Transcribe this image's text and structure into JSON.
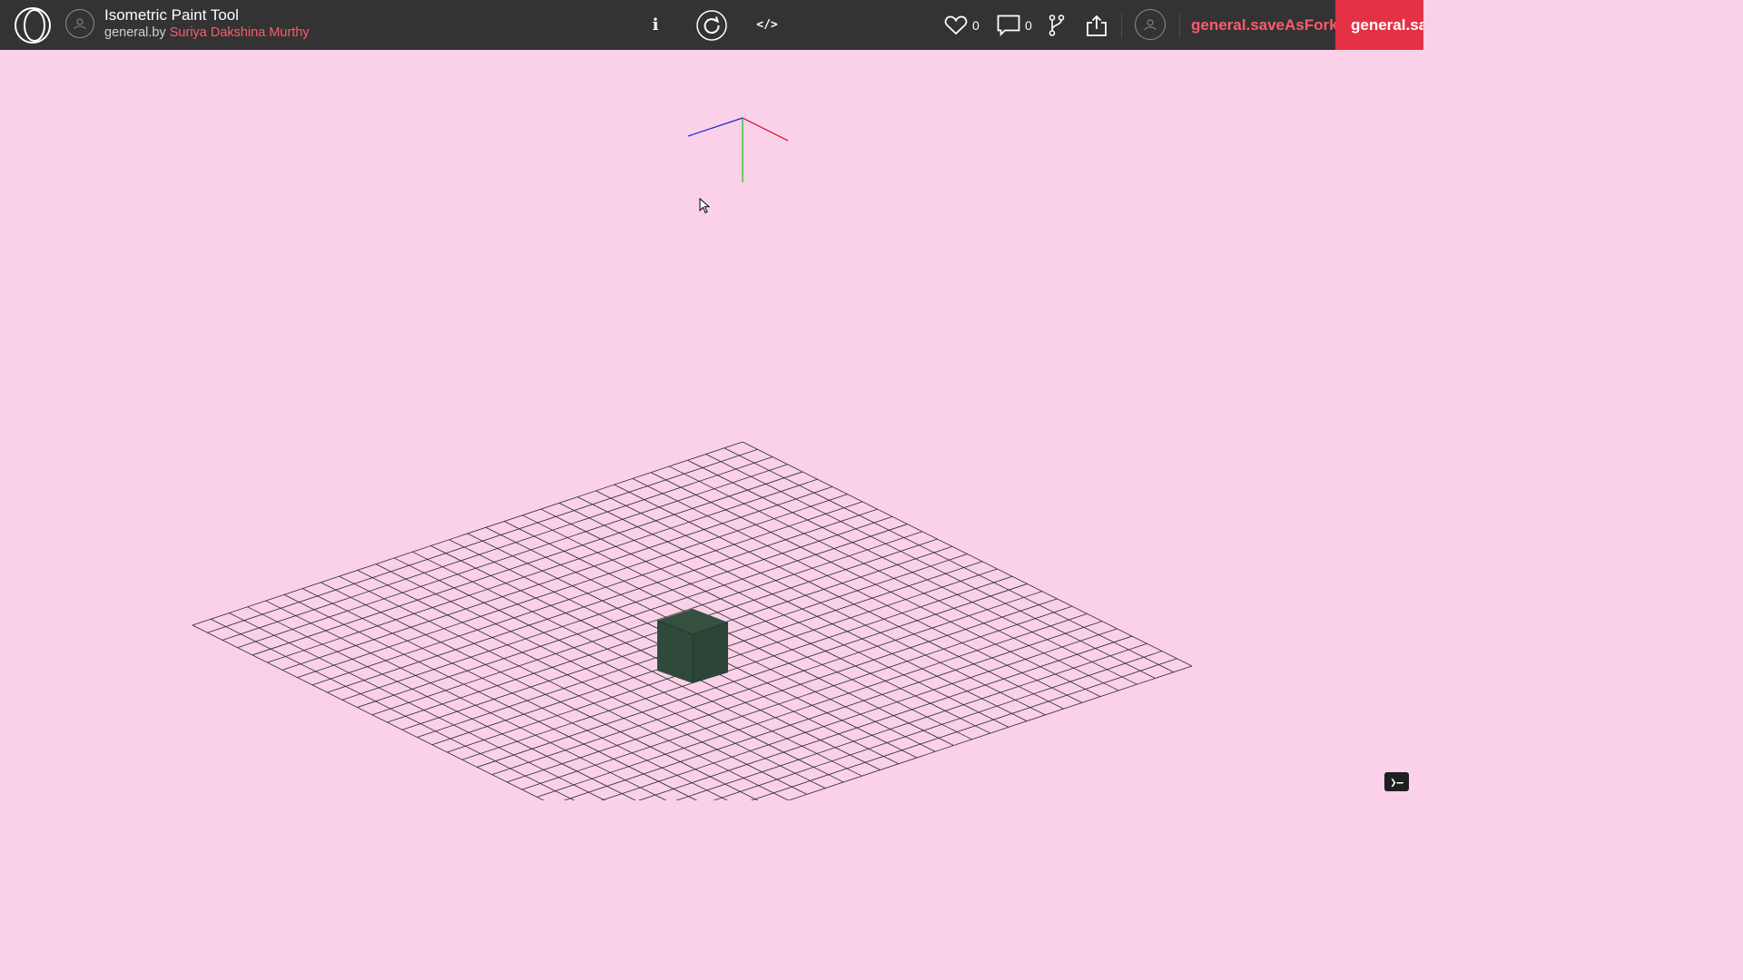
{
  "header": {
    "title": "Isometric Paint Tool",
    "byline_prefix": "general.by",
    "author": "Suriya Dakshina Murthy",
    "info_label": "i",
    "code_label": "</>",
    "likes_count": "0",
    "comments_count": "0",
    "fork_save_label": "general.saveAsFork",
    "save_label": "general.save"
  },
  "icons": {
    "logo": "logo-icon",
    "author_avatar": "avatar-icon",
    "refresh": "refresh-icon",
    "like": "heart-icon",
    "comment": "comment-icon",
    "fork": "fork-icon",
    "share": "share-icon",
    "user": "user-icon",
    "console": "terminal-icon"
  },
  "scene": {
    "background": "#fad1e8",
    "grid_color": "#2a2a2a",
    "grid_divisions": 30,
    "cube_color": "#2f4a3a",
    "axis_colors": {
      "x": "#e0001a",
      "y": "#00cc00",
      "z": "#2020e0"
    }
  },
  "console_label": "❯—"
}
